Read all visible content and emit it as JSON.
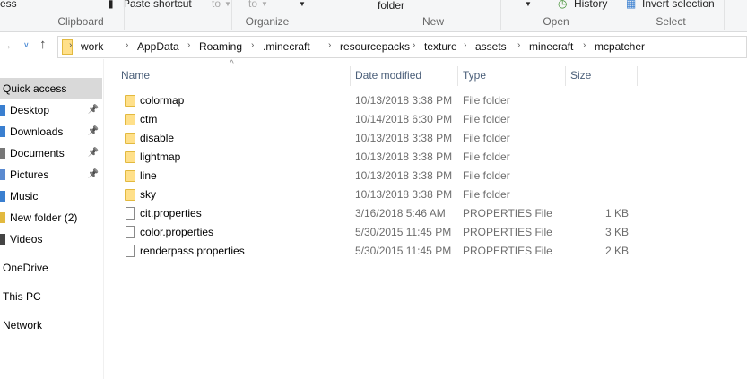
{
  "ribbon": {
    "partial_left": "ess",
    "paste_shortcut": "Paste shortcut",
    "move_to": "to",
    "copy_to": "to",
    "new_folder": "folder",
    "history": "History",
    "invert_selection": "Invert selection",
    "groups": [
      "Clipboard",
      "Organize",
      "New",
      "Open",
      "Select"
    ]
  },
  "address": {
    "crumbs": [
      "work",
      "AppData",
      "Roaming",
      ".minecraft",
      "resourcepacks",
      "texture",
      "assets",
      "minecraft",
      "mcpatcher"
    ]
  },
  "sidebar": {
    "items": [
      {
        "label": "Quick access",
        "pinned": false
      },
      {
        "label": "Desktop",
        "pinned": true
      },
      {
        "label": "Downloads",
        "pinned": true
      },
      {
        "label": "Documents",
        "pinned": true
      },
      {
        "label": "Pictures",
        "pinned": true
      },
      {
        "label": "Music",
        "pinned": false
      },
      {
        "label": "New folder (2)",
        "pinned": false
      },
      {
        "label": "Videos",
        "pinned": false
      },
      {
        "label": "OneDrive",
        "pinned": false
      },
      {
        "label": "This PC",
        "pinned": false
      },
      {
        "label": "Network",
        "pinned": false
      }
    ]
  },
  "columns": {
    "name": "Name",
    "date": "Date modified",
    "type": "Type",
    "size": "Size"
  },
  "files": [
    {
      "name": "colormap",
      "date": "10/13/2018 3:38 PM",
      "type": "File folder",
      "size": "",
      "kind": "folder"
    },
    {
      "name": "ctm",
      "date": "10/14/2018 6:30 PM",
      "type": "File folder",
      "size": "",
      "kind": "folder"
    },
    {
      "name": "disable",
      "date": "10/13/2018 3:38 PM",
      "type": "File folder",
      "size": "",
      "kind": "folder"
    },
    {
      "name": "lightmap",
      "date": "10/13/2018 3:38 PM",
      "type": "File folder",
      "size": "",
      "kind": "folder"
    },
    {
      "name": "line",
      "date": "10/13/2018 3:38 PM",
      "type": "File folder",
      "size": "",
      "kind": "folder"
    },
    {
      "name": "sky",
      "date": "10/13/2018 3:38 PM",
      "type": "File folder",
      "size": "",
      "kind": "folder"
    },
    {
      "name": "cit.properties",
      "date": "3/16/2018 5:46 AM",
      "type": "PROPERTIES File",
      "size": "1 KB",
      "kind": "file"
    },
    {
      "name": "color.properties",
      "date": "5/30/2015 11:45 PM",
      "type": "PROPERTIES File",
      "size": "3 KB",
      "kind": "file"
    },
    {
      "name": "renderpass.properties",
      "date": "5/30/2015 11:45 PM",
      "type": "PROPERTIES File",
      "size": "2 KB",
      "kind": "file"
    }
  ]
}
